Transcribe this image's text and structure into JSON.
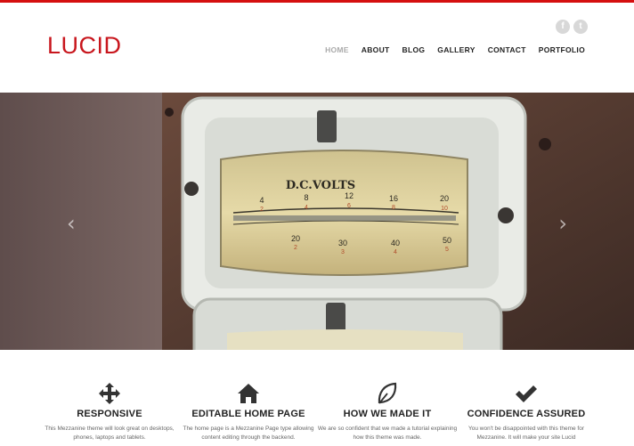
{
  "header": {
    "logo": "LUCID",
    "social": [
      {
        "name": "facebook-icon",
        "glyph": "f"
      },
      {
        "name": "twitter-icon",
        "glyph": "t"
      }
    ],
    "nav": [
      {
        "label": "HOME",
        "active": true
      },
      {
        "label": "ABOUT"
      },
      {
        "label": "BLOG"
      },
      {
        "label": "GALLERY"
      },
      {
        "label": "CONTACT"
      },
      {
        "label": "PORTFOLIO"
      }
    ]
  },
  "hero": {
    "prev_arrow": "‹",
    "next_arrow": "›",
    "meter": {
      "label": "D.C.VOLTS",
      "top_scale": [
        "4",
        "8",
        "12",
        "16",
        "20"
      ],
      "top_sub": [
        "2",
        "4",
        "6",
        "8",
        "10"
      ],
      "bottom_scale": [
        "20",
        "30",
        "40",
        "50"
      ],
      "bottom_sub": [
        "2",
        "3",
        "4",
        "5"
      ]
    }
  },
  "features": [
    {
      "icon": "move-arrows-icon",
      "title": "RESPONSIVE",
      "text": "This Mezzanine theme will look great on desktops, phones, laptops and tablets."
    },
    {
      "icon": "home-icon",
      "title": "EDITABLE HOME PAGE",
      "text": "The home page is a Mezzanine Page type allowing content editing through the backend."
    },
    {
      "icon": "leaf-icon",
      "title": "HOW WE MADE IT",
      "text": "We are so confident that we made a tutorial explaining how this theme was made."
    },
    {
      "icon": "checkmark-icon",
      "title": "CONFIDENCE ASSURED",
      "text": "You won't be disappointed with this theme for Mezzanine. It will make your site Lucid"
    }
  ],
  "colors": {
    "accent": "#c8161d",
    "topbar": "#d50f0f"
  }
}
